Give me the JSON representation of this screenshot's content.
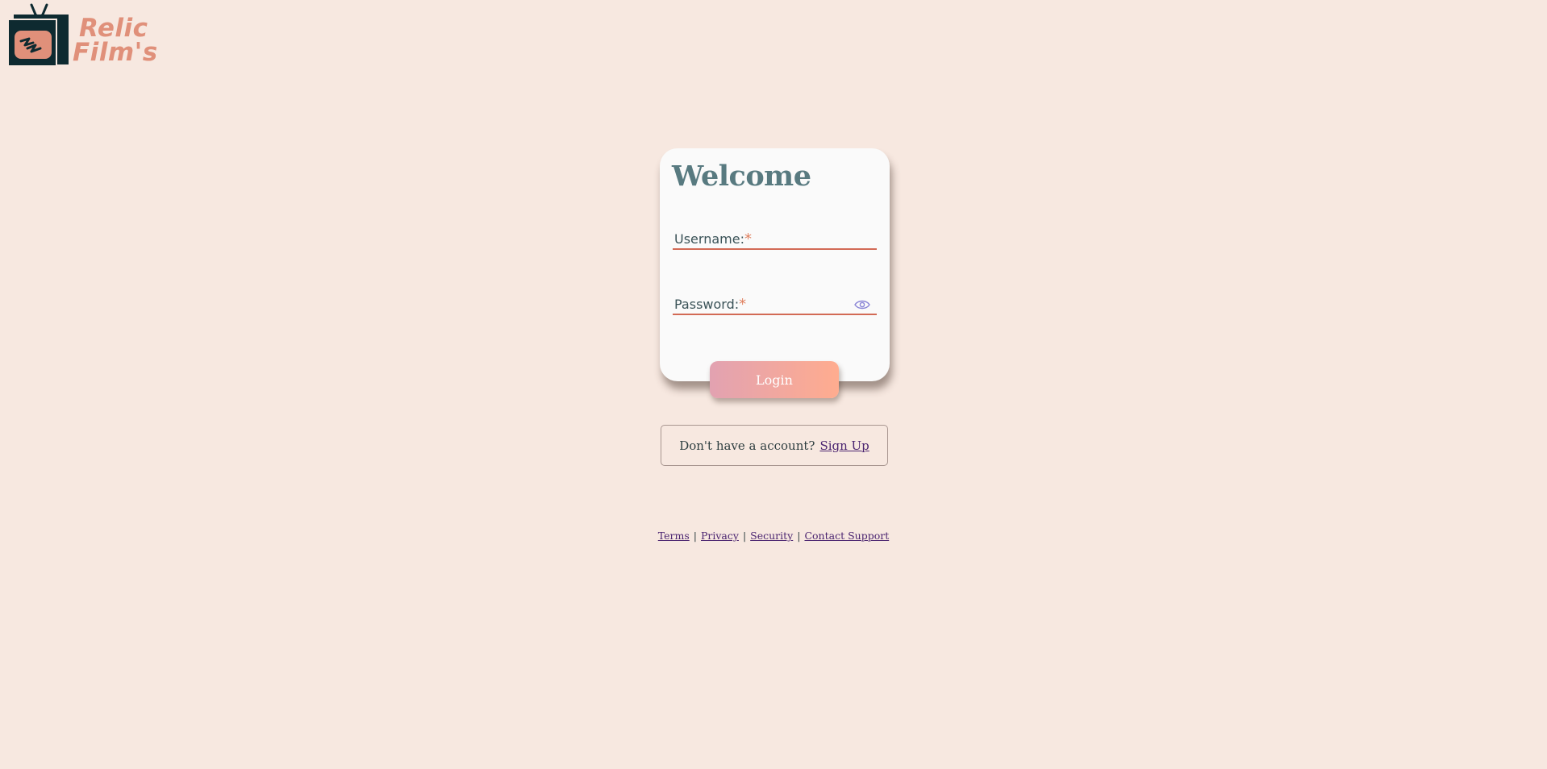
{
  "brand": {
    "line1": "Relic",
    "line2": "Film's",
    "accent_color": "#e0907a",
    "dark_color": "#0e2a30"
  },
  "login_card": {
    "title": "Welcome",
    "username_label": "Username:",
    "password_label": "Password:",
    "required_mark": "*",
    "username_value": "",
    "password_value": "",
    "password_toggle_icon": "eye-icon",
    "login_button": "Login"
  },
  "signup": {
    "prompt": "Don't have a account?",
    "link": "Sign Up"
  },
  "footer": {
    "links": [
      "Terms",
      "Privacy",
      "Security",
      "Contact Support"
    ],
    "separator": "|"
  },
  "colors": {
    "background": "#f7e8e0",
    "card": "#fafafa",
    "title": "#587a80",
    "underline": "#d26a55",
    "link": "#4b2470",
    "button_gradient_start": "#e2a2b1",
    "button_gradient_end": "#ffac8f"
  }
}
